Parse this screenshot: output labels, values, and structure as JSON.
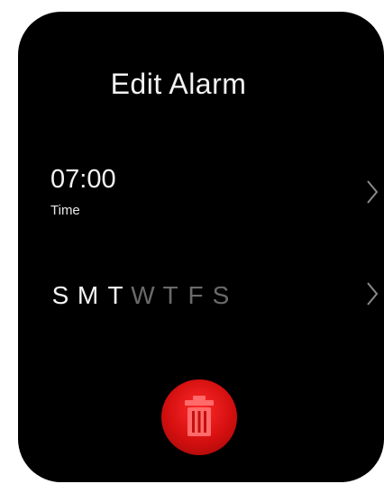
{
  "header": {
    "title": "Edit Alarm"
  },
  "time_row": {
    "value": "07:00",
    "label": "Time",
    "chevron_icon": "chevron-right-icon"
  },
  "days_row": {
    "days": [
      {
        "letter": "S",
        "selected": true
      },
      {
        "letter": "M",
        "selected": true
      },
      {
        "letter": "T",
        "selected": true
      },
      {
        "letter": "W",
        "selected": false
      },
      {
        "letter": "T",
        "selected": false
      },
      {
        "letter": "F",
        "selected": false
      },
      {
        "letter": "S",
        "selected": false
      }
    ],
    "chevron_icon": "chevron-right-icon"
  },
  "delete": {
    "icon": "trash-icon",
    "color": "#e01515"
  },
  "colors": {
    "background": "#000000",
    "text": "#f2f2f2",
    "inactive_day": "#6a6a6a",
    "accent_delete": "#e01515"
  }
}
